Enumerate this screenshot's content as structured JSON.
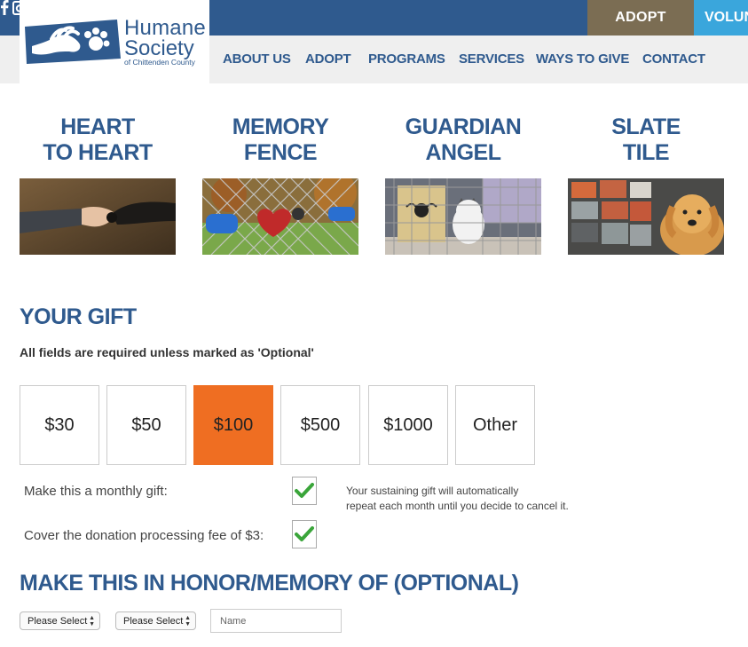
{
  "header": {
    "logo": {
      "line1": "Humane",
      "line2": "Society",
      "line3": "of Chittenden County"
    },
    "social": [
      "facebook-icon",
      "instagram-icon",
      "email-icon",
      "rss-icon"
    ],
    "adopt_button": "ADOPT",
    "volunteer_button": "VOLUN",
    "nav": [
      "ABOUT US",
      "ADOPT",
      "PROGRAMS",
      "SERVICES",
      "WAYS TO GIVE",
      "CONTACT"
    ]
  },
  "tiles": [
    {
      "title1": "HEART",
      "title2": "TO HEART"
    },
    {
      "title1": "MEMORY",
      "title2": "FENCE"
    },
    {
      "title1": "GUARDIAN",
      "title2": "ANGEL"
    },
    {
      "title1": "SLATE",
      "title2": "TILE"
    }
  ],
  "gift": {
    "heading": "YOUR GIFT",
    "required_note": "All fields are required unless marked as 'Optional'",
    "amounts": [
      "$30",
      "$50",
      "$100",
      "$500",
      "$1000",
      "Other"
    ],
    "selected_amount": "$100",
    "monthly_label": "Make this a monthly gift:",
    "monthly_checked": true,
    "monthly_note_line1": "Your sustaining gift will automatically",
    "monthly_note_line2": "repeat each month until you decide to cancel it.",
    "fee_label": "Cover the donation processing fee of $3:",
    "fee_checked": true
  },
  "honor": {
    "heading": "MAKE THIS IN HONOR/MEMORY OF (OPTIONAL)",
    "select1": "Please Select",
    "select2": "Please Select",
    "name_placeholder": "Name"
  },
  "colors": {
    "brand_blue": "#2f5a8e",
    "adopt_brown": "#7b6d53",
    "volunteer_blue": "#3aa6dc",
    "selected_orange": "#ef6e22",
    "check_green": "#3aa53a"
  }
}
